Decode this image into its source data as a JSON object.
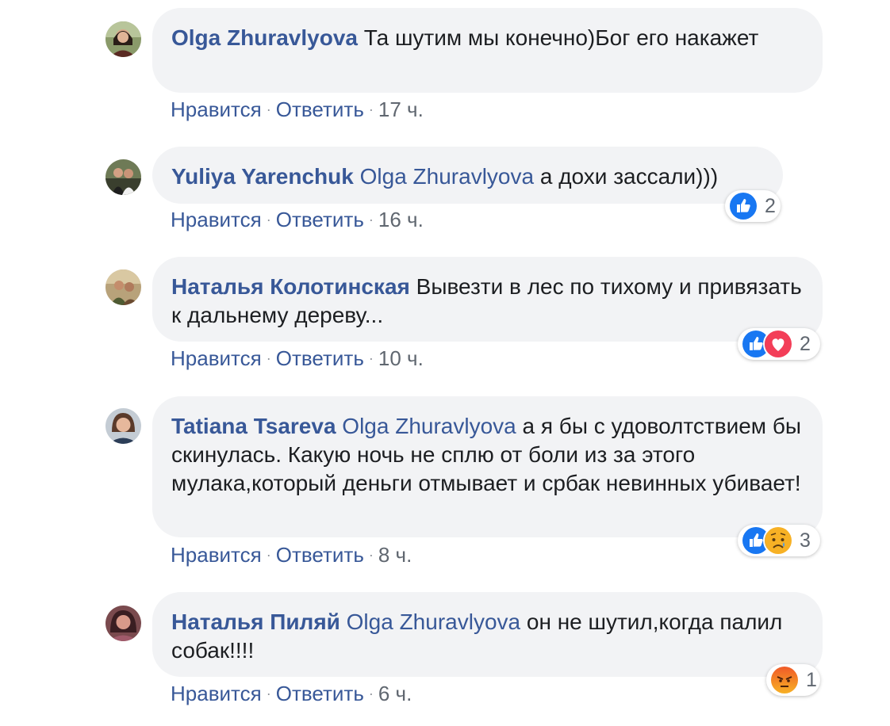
{
  "actions": {
    "like": "Нравится",
    "reply": "Ответить",
    "separator": "·"
  },
  "comments": [
    {
      "author": "Olga Zhuravlyova",
      "mention": "",
      "text": "Та шутим мы конечно)Бог его накажет",
      "time": "17 ч.",
      "reactions": [],
      "reaction_count": ""
    },
    {
      "author": "Yuliya Yarenchuk",
      "mention": "Olga Zhuravlyova",
      "text": "а дохи зассали)))",
      "time": "16 ч.",
      "reactions": [
        "like-icon"
      ],
      "reaction_count": "2"
    },
    {
      "author": "Наталья Колотинская",
      "mention": "",
      "text": "Вывезти в лес по тихому и привязать к дальнему дереву...",
      "time": "10 ч.",
      "reactions": [
        "like-icon",
        "love-icon"
      ],
      "reaction_count": "2"
    },
    {
      "author": "Tatiana Tsareva",
      "mention": "Olga Zhuravlyova",
      "text": "а я бы с удоволтствием бы скинулась. Какую ночь не сплю от боли из за этого мулака,который деньги отмывает и србак невинных убивает!",
      "time": "8 ч.",
      "reactions": [
        "like-icon",
        "sad-icon"
      ],
      "reaction_count": "3"
    },
    {
      "author": "Наталья Пиляй",
      "mention": "Olga Zhuravlyova",
      "text": "он не шутил,когда палил собак!!!!",
      "time": "6 ч.",
      "reactions": [
        "angry-icon"
      ],
      "reaction_count": "1"
    }
  ],
  "colors": {
    "link": "#385898",
    "bubble": "#f2f3f5",
    "like": "#1877f2",
    "love": "#f33e58",
    "sad": "#f7b125",
    "angry": "#e9710f"
  }
}
